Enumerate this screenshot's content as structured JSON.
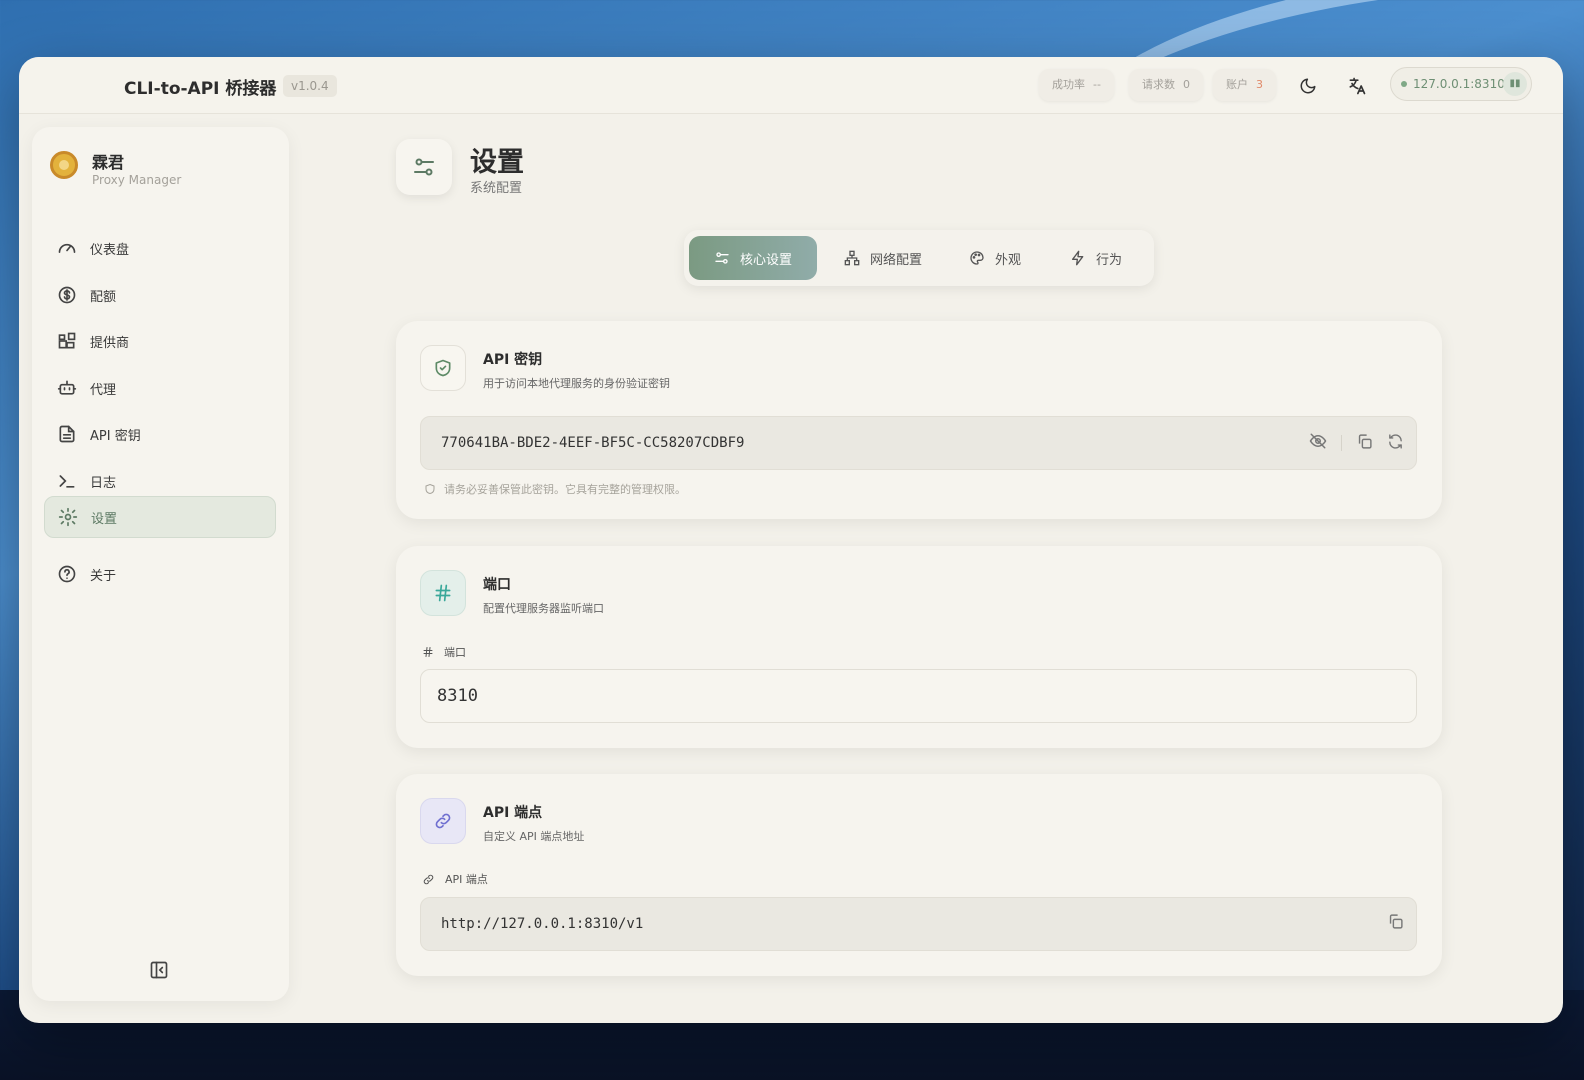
{
  "app": {
    "title": "CLI-to-API 桥接器",
    "version": "v1.0.4"
  },
  "stats": [
    {
      "label": "成功率",
      "value": "--",
      "color": "#a3a09a"
    },
    {
      "label": "请求数",
      "value": "0",
      "color": "#a3a09a"
    },
    {
      "label": "账户",
      "value": "3",
      "color": "#e08a6a"
    }
  ],
  "server": {
    "address": "127.0.0.1:8310",
    "status_color": "#7fa886"
  },
  "brand": {
    "name": "霖君",
    "subtitle": "Proxy Manager"
  },
  "nav": [
    {
      "label": "仪表盘",
      "icon": "gauge-icon"
    },
    {
      "label": "配额",
      "icon": "dollar-icon"
    },
    {
      "label": "提供商",
      "icon": "blocks-icon"
    },
    {
      "label": "代理",
      "icon": "bot-icon"
    },
    {
      "label": "API 密钥",
      "icon": "file-icon"
    },
    {
      "label": "日志",
      "icon": "terminal-icon"
    },
    {
      "label": "设置",
      "icon": "gear-icon",
      "active": true
    },
    {
      "label": "关于",
      "icon": "help-icon"
    }
  ],
  "page": {
    "title": "设置",
    "subtitle": "系统配置"
  },
  "tabs": [
    {
      "label": "核心设置",
      "active": true
    },
    {
      "label": "网络配置"
    },
    {
      "label": "外观"
    },
    {
      "label": "行为"
    }
  ],
  "api_key": {
    "title": "API 密钥",
    "description": "用于访问本地代理服务的身份验证密钥",
    "value": "770641BA-BDE2-4EEF-BF5C-CC58207CDBF9",
    "hint": "请务必妥善保管此密钥。它具有完整的管理权限。"
  },
  "port": {
    "title": "端口",
    "description": "配置代理服务器监听端口",
    "label": "端口",
    "value": "8310"
  },
  "endpoint": {
    "title": "API 端点",
    "description": "自定义 API 端点地址",
    "label": "API 端点",
    "value": "http://127.0.0.1:8310/v1"
  },
  "colors": {
    "accent": "#7b9a82",
    "port_icon": "#3aa89a",
    "endpoint_icon": "#6f6fd0"
  }
}
